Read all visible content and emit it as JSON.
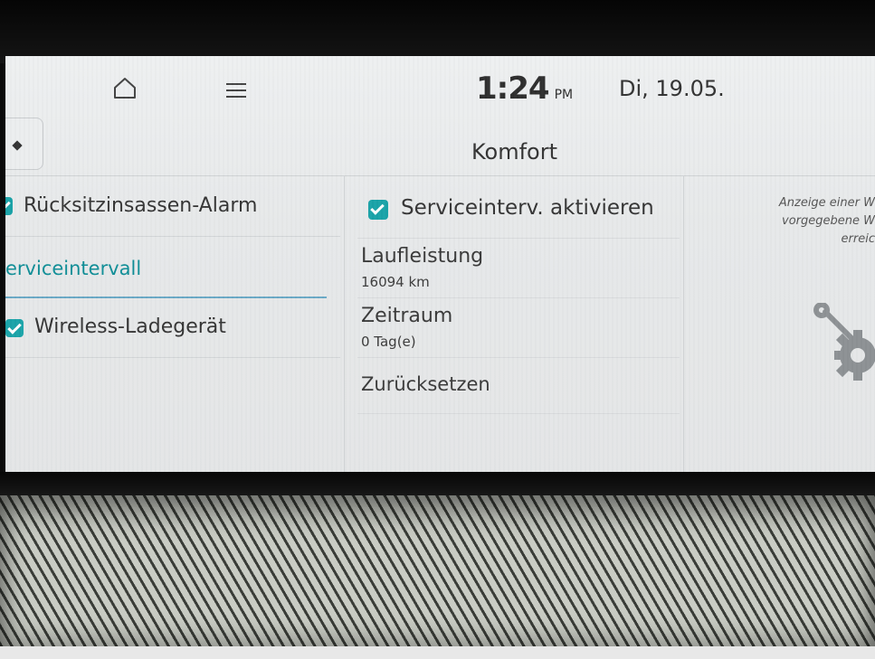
{
  "status": {
    "time": "1:24",
    "ampm": "PM",
    "date": "Di, 19.05."
  },
  "header": {
    "title": "Komfort"
  },
  "sidebar": {
    "items": [
      {
        "label": "Rücksitzinsassen-Alarm",
        "checked": true
      },
      {
        "label": "erviceintervall",
        "selected": true
      },
      {
        "label": "Wireless-Ladegerät",
        "checked": true
      }
    ]
  },
  "service": {
    "activate_label": "Serviceinterv. aktivieren",
    "activate_checked": true,
    "mileage_label": "Laufleistung",
    "mileage_value": "16094 km",
    "period_label": "Zeitraum",
    "period_value": "0 Tag(e)",
    "reset_label": "Zurücksetzen"
  },
  "info": {
    "line1": "Anzeige einer W",
    "line2": "vorgegebene W",
    "line3": "erreic"
  },
  "colors": {
    "accent": "#1aa3a8",
    "selected_text": "#0f8e97"
  }
}
